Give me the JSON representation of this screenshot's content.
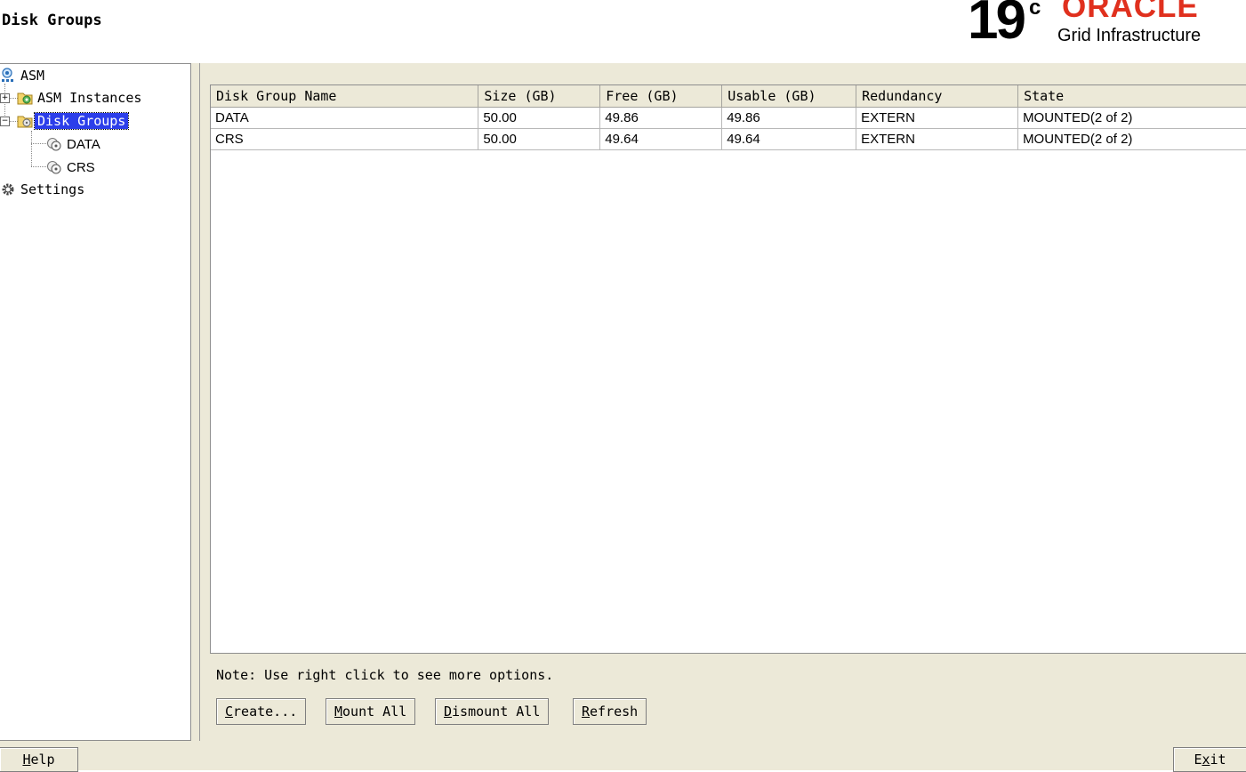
{
  "header": {
    "title": "Disk Groups"
  },
  "logo": {
    "version": "19",
    "version_sup": "c",
    "brand": "ORACLE",
    "product": "Grid Infrastructure"
  },
  "tree": {
    "root": "ASM",
    "asm_instances": "ASM Instances",
    "disk_groups": "Disk Groups",
    "dg_data": "DATA",
    "dg_crs": "CRS",
    "settings": "Settings"
  },
  "table": {
    "columns": [
      "Disk Group Name",
      "Size (GB)",
      "Free (GB)",
      "Usable (GB)",
      "Redundancy",
      "State"
    ],
    "rows": [
      [
        "DATA",
        "50.00",
        "49.86",
        "49.86",
        "EXTERN",
        "MOUNTED(2 of 2)"
      ],
      [
        "CRS",
        "50.00",
        "49.64",
        "49.64",
        "EXTERN",
        "MOUNTED(2 of 2)"
      ]
    ]
  },
  "note": "Note: Use right click to see more options.",
  "buttons": {
    "create_m": "C",
    "create_rest": "reate...",
    "mount_m": "M",
    "mount_rest": "ount All",
    "dismount_m": "D",
    "dismount_rest": "ismount All",
    "refresh_m": "R",
    "refresh_rest": "efresh"
  },
  "footer": {
    "help_m": "H",
    "help_rest": "elp",
    "exit_pre": "E",
    "exit_m": "x",
    "exit_rest": "it"
  }
}
